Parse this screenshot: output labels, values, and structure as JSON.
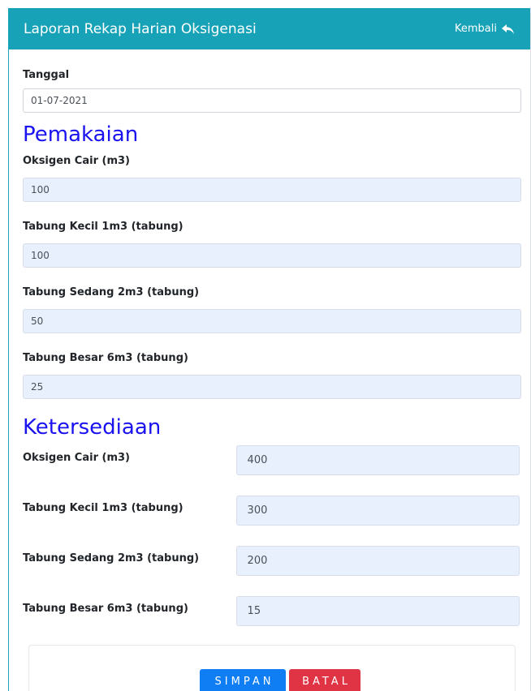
{
  "header": {
    "title": "Laporan Rekap Harian Oksigenasi",
    "back_label": "Kembali"
  },
  "date": {
    "label": "Tanggal",
    "value": "01-07-2021"
  },
  "usage": {
    "title": "Pemakaian",
    "fields": [
      {
        "label": "Oksigen Cair (m3)",
        "value": "100"
      },
      {
        "label": "Tabung Kecil 1m3 (tabung)",
        "value": "100"
      },
      {
        "label": "Tabung Sedang 2m3 (tabung)",
        "value": "50"
      },
      {
        "label": "Tabung Besar 6m3 (tabung)",
        "value": "25"
      }
    ]
  },
  "availability": {
    "title": "Ketersediaan",
    "fields": [
      {
        "label": "Oksigen Cair (m3)",
        "value": "400"
      },
      {
        "label": "Tabung Kecil 1m3 (tabung)",
        "value": "300"
      },
      {
        "label": "Tabung Sedang 2m3 (tabung)",
        "value": "200"
      },
      {
        "label": "Tabung Besar 6m3 (tabung)",
        "value": "15"
      }
    ]
  },
  "actions": {
    "save_label": "SIMPAN",
    "cancel_label": "BATAL"
  },
  "colors": {
    "header": "#17a2b8",
    "section_title": "#1a12f0",
    "save": "#0f7ef5",
    "cancel": "#e03445",
    "filled_field": "#e8f0fe"
  }
}
